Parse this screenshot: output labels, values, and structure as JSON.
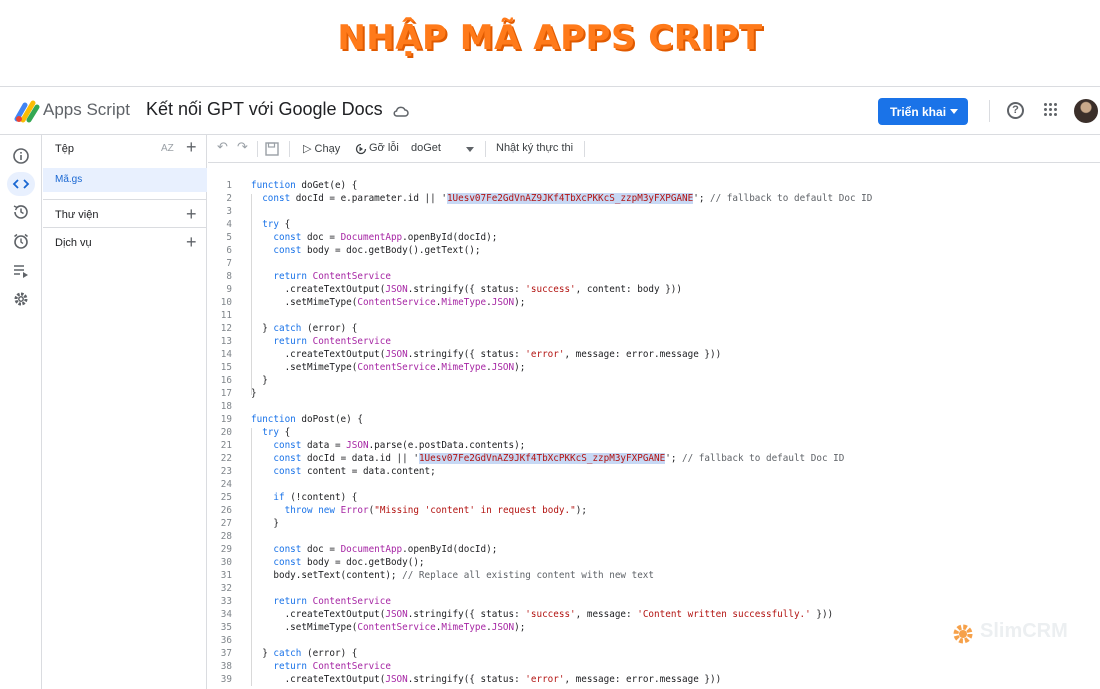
{
  "banner": {
    "title": "NHẬP MÃ APPS CRIPT"
  },
  "header": {
    "app_name": "Apps Script",
    "project_title": "Kết nối GPT với Google Docs",
    "deploy_label": "Triển khai",
    "help_glyph": "?"
  },
  "sidebar": {
    "files_label": "Tệp",
    "sort_label": "AZ",
    "add_glyph": "+",
    "files": [
      "Mã.gs"
    ],
    "libraries_label": "Thư viện",
    "services_label": "Dịch vụ"
  },
  "toolbar": {
    "undo_glyph": "↶",
    "redo_glyph": "↷",
    "run_label": "▷ Chạy",
    "debug_label": "Gỡ lỗi",
    "function_select": "doGet",
    "log_label": "Nhật ký thực thi"
  },
  "code": {
    "lines": [
      {
        "n": "1",
        "html": "<span class='kw'>function</span> doGet(e) {"
      },
      {
        "n": "2",
        "html": "  <span class='kw'>const</span> docId = e.parameter.id || '<span class='sel'>1Uesv07Fe2GdVnAZ9JKf4TbXcPKKcS_zzpM3yFXPGANE</span>'; <span class='cm'>// fallback to default Doc ID</span>"
      },
      {
        "n": "3",
        "html": ""
      },
      {
        "n": "4",
        "html": "  <span class='kw'>try</span> {"
      },
      {
        "n": "5",
        "html": "    <span class='kw'>const</span> doc = <span class='cls'>DocumentApp</span>.openById(docId);"
      },
      {
        "n": "6",
        "html": "    <span class='kw'>const</span> body = doc.getBody().getText();"
      },
      {
        "n": "7",
        "html": ""
      },
      {
        "n": "8",
        "html": "    <span class='kw'>return</span> <span class='cls'>ContentService</span>"
      },
      {
        "n": "9",
        "html": "      .createTextOutput(<span class='cls'>JSON</span>.stringify({ status: <span class='str'>'success'</span>, content: body }))"
      },
      {
        "n": "10",
        "html": "      .setMimeType(<span class='cls'>ContentService</span>.<span class='cls'>MimeType</span>.<span class='cls'>JSON</span>);"
      },
      {
        "n": "11",
        "html": ""
      },
      {
        "n": "12",
        "html": "  } <span class='kw'>catch</span> (error) {"
      },
      {
        "n": "13",
        "html": "    <span class='kw'>return</span> <span class='cls'>ContentService</span>"
      },
      {
        "n": "14",
        "html": "      .createTextOutput(<span class='cls'>JSON</span>.stringify({ status: <span class='str'>'error'</span>, message: error.message }))"
      },
      {
        "n": "15",
        "html": "      .setMimeType(<span class='cls'>ContentService</span>.<span class='cls'>MimeType</span>.<span class='cls'>JSON</span>);"
      },
      {
        "n": "16",
        "html": "  }"
      },
      {
        "n": "17",
        "html": "}"
      },
      {
        "n": "18",
        "html": ""
      },
      {
        "n": "19",
        "html": "<span class='kw'>function</span> doPost(e) {"
      },
      {
        "n": "20",
        "html": "  <span class='kw'>try</span> {"
      },
      {
        "n": "21",
        "html": "    <span class='kw'>const</span> data = <span class='cls'>JSON</span>.parse(e.postData.contents);"
      },
      {
        "n": "22",
        "html": "    <span class='kw'>const</span> docId = data.id || '<span class='sel'>1Uesv07Fe2GdVnAZ9JKf4TbXcPKKcS_zzpM3yFXPGANE</span>'; <span class='cm'>// fallback to default Doc ID</span>"
      },
      {
        "n": "23",
        "html": "    <span class='kw'>const</span> content = data.content;"
      },
      {
        "n": "24",
        "html": ""
      },
      {
        "n": "25",
        "html": "    <span class='kw'>if</span> (!content) {"
      },
      {
        "n": "26",
        "html": "      <span class='kw'>throw</span> <span class='kw'>new</span> <span class='cls'>Error</span>(<span class='str'>\"Missing 'content' in request body.\"</span>);"
      },
      {
        "n": "27",
        "html": "    }"
      },
      {
        "n": "28",
        "html": ""
      },
      {
        "n": "29",
        "html": "    <span class='kw'>const</span> doc = <span class='cls'>DocumentApp</span>.openById(docId);"
      },
      {
        "n": "30",
        "html": "    <span class='kw'>const</span> body = doc.getBody();"
      },
      {
        "n": "31",
        "html": "    body.setText(content); <span class='cm'>// Replace all existing content with new text</span>"
      },
      {
        "n": "32",
        "html": ""
      },
      {
        "n": "33",
        "html": "    <span class='kw'>return</span> <span class='cls'>ContentService</span>"
      },
      {
        "n": "34",
        "html": "      .createTextOutput(<span class='cls'>JSON</span>.stringify({ status: <span class='str'>'success'</span>, message: <span class='str'>'Content written successfully.'</span> }))"
      },
      {
        "n": "35",
        "html": "      .setMimeType(<span class='cls'>ContentService</span>.<span class='cls'>MimeType</span>.<span class='cls'>JSON</span>);"
      },
      {
        "n": "36",
        "html": ""
      },
      {
        "n": "37",
        "html": "  } <span class='kw'>catch</span> (error) {"
      },
      {
        "n": "38",
        "html": "    <span class='kw'>return</span> <span class='cls'>ContentService</span>"
      },
      {
        "n": "39",
        "html": "      .createTextOutput(<span class='cls'>JSON</span>.stringify({ status: <span class='str'>'error'</span>, message: error.message }))"
      }
    ]
  },
  "watermark": {
    "text": "SlimCRM"
  },
  "colors": {
    "accent": "#1a73e8",
    "banner": "#ff7a1a",
    "selection": "#c7d8f4"
  }
}
